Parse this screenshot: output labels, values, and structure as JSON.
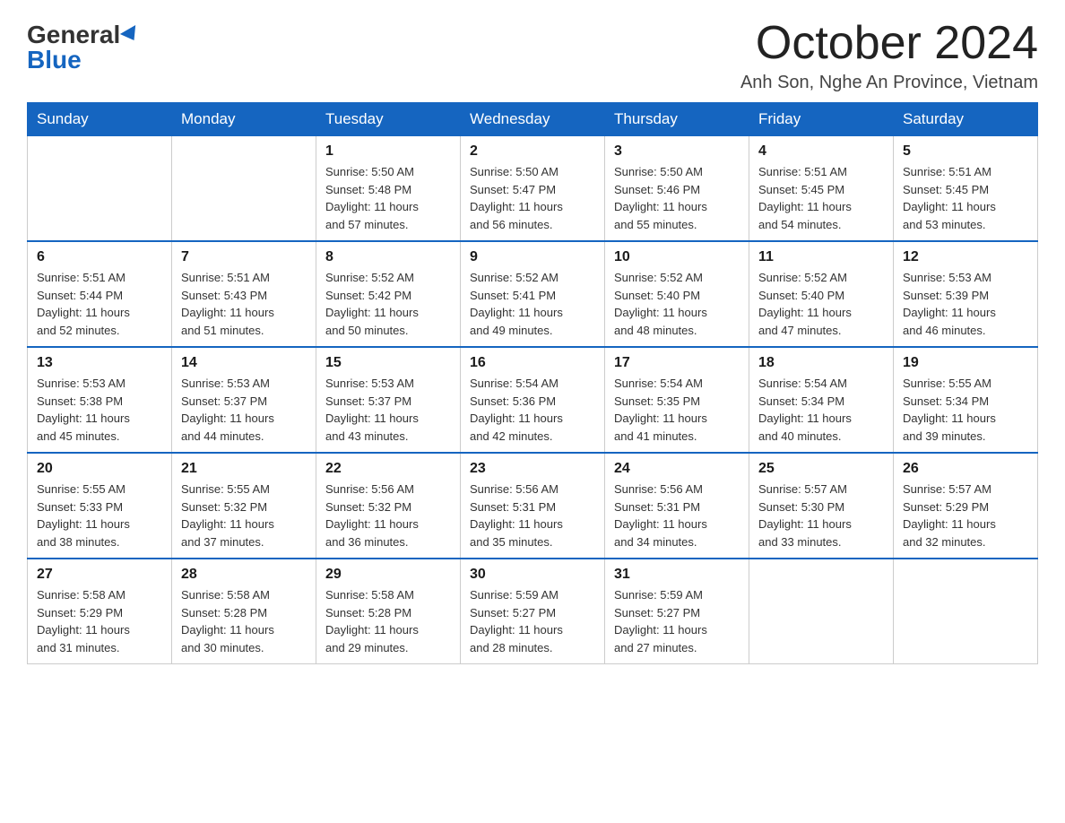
{
  "header": {
    "logo_general": "General",
    "logo_blue": "Blue",
    "title": "October 2024",
    "location": "Anh Son, Nghe An Province, Vietnam"
  },
  "days_of_week": [
    "Sunday",
    "Monday",
    "Tuesday",
    "Wednesday",
    "Thursday",
    "Friday",
    "Saturday"
  ],
  "weeks": [
    [
      {
        "day": "",
        "info": ""
      },
      {
        "day": "",
        "info": ""
      },
      {
        "day": "1",
        "info": "Sunrise: 5:50 AM\nSunset: 5:48 PM\nDaylight: 11 hours\nand 57 minutes."
      },
      {
        "day": "2",
        "info": "Sunrise: 5:50 AM\nSunset: 5:47 PM\nDaylight: 11 hours\nand 56 minutes."
      },
      {
        "day": "3",
        "info": "Sunrise: 5:50 AM\nSunset: 5:46 PM\nDaylight: 11 hours\nand 55 minutes."
      },
      {
        "day": "4",
        "info": "Sunrise: 5:51 AM\nSunset: 5:45 PM\nDaylight: 11 hours\nand 54 minutes."
      },
      {
        "day": "5",
        "info": "Sunrise: 5:51 AM\nSunset: 5:45 PM\nDaylight: 11 hours\nand 53 minutes."
      }
    ],
    [
      {
        "day": "6",
        "info": "Sunrise: 5:51 AM\nSunset: 5:44 PM\nDaylight: 11 hours\nand 52 minutes."
      },
      {
        "day": "7",
        "info": "Sunrise: 5:51 AM\nSunset: 5:43 PM\nDaylight: 11 hours\nand 51 minutes."
      },
      {
        "day": "8",
        "info": "Sunrise: 5:52 AM\nSunset: 5:42 PM\nDaylight: 11 hours\nand 50 minutes."
      },
      {
        "day": "9",
        "info": "Sunrise: 5:52 AM\nSunset: 5:41 PM\nDaylight: 11 hours\nand 49 minutes."
      },
      {
        "day": "10",
        "info": "Sunrise: 5:52 AM\nSunset: 5:40 PM\nDaylight: 11 hours\nand 48 minutes."
      },
      {
        "day": "11",
        "info": "Sunrise: 5:52 AM\nSunset: 5:40 PM\nDaylight: 11 hours\nand 47 minutes."
      },
      {
        "day": "12",
        "info": "Sunrise: 5:53 AM\nSunset: 5:39 PM\nDaylight: 11 hours\nand 46 minutes."
      }
    ],
    [
      {
        "day": "13",
        "info": "Sunrise: 5:53 AM\nSunset: 5:38 PM\nDaylight: 11 hours\nand 45 minutes."
      },
      {
        "day": "14",
        "info": "Sunrise: 5:53 AM\nSunset: 5:37 PM\nDaylight: 11 hours\nand 44 minutes."
      },
      {
        "day": "15",
        "info": "Sunrise: 5:53 AM\nSunset: 5:37 PM\nDaylight: 11 hours\nand 43 minutes."
      },
      {
        "day": "16",
        "info": "Sunrise: 5:54 AM\nSunset: 5:36 PM\nDaylight: 11 hours\nand 42 minutes."
      },
      {
        "day": "17",
        "info": "Sunrise: 5:54 AM\nSunset: 5:35 PM\nDaylight: 11 hours\nand 41 minutes."
      },
      {
        "day": "18",
        "info": "Sunrise: 5:54 AM\nSunset: 5:34 PM\nDaylight: 11 hours\nand 40 minutes."
      },
      {
        "day": "19",
        "info": "Sunrise: 5:55 AM\nSunset: 5:34 PM\nDaylight: 11 hours\nand 39 minutes."
      }
    ],
    [
      {
        "day": "20",
        "info": "Sunrise: 5:55 AM\nSunset: 5:33 PM\nDaylight: 11 hours\nand 38 minutes."
      },
      {
        "day": "21",
        "info": "Sunrise: 5:55 AM\nSunset: 5:32 PM\nDaylight: 11 hours\nand 37 minutes."
      },
      {
        "day": "22",
        "info": "Sunrise: 5:56 AM\nSunset: 5:32 PM\nDaylight: 11 hours\nand 36 minutes."
      },
      {
        "day": "23",
        "info": "Sunrise: 5:56 AM\nSunset: 5:31 PM\nDaylight: 11 hours\nand 35 minutes."
      },
      {
        "day": "24",
        "info": "Sunrise: 5:56 AM\nSunset: 5:31 PM\nDaylight: 11 hours\nand 34 minutes."
      },
      {
        "day": "25",
        "info": "Sunrise: 5:57 AM\nSunset: 5:30 PM\nDaylight: 11 hours\nand 33 minutes."
      },
      {
        "day": "26",
        "info": "Sunrise: 5:57 AM\nSunset: 5:29 PM\nDaylight: 11 hours\nand 32 minutes."
      }
    ],
    [
      {
        "day": "27",
        "info": "Sunrise: 5:58 AM\nSunset: 5:29 PM\nDaylight: 11 hours\nand 31 minutes."
      },
      {
        "day": "28",
        "info": "Sunrise: 5:58 AM\nSunset: 5:28 PM\nDaylight: 11 hours\nand 30 minutes."
      },
      {
        "day": "29",
        "info": "Sunrise: 5:58 AM\nSunset: 5:28 PM\nDaylight: 11 hours\nand 29 minutes."
      },
      {
        "day": "30",
        "info": "Sunrise: 5:59 AM\nSunset: 5:27 PM\nDaylight: 11 hours\nand 28 minutes."
      },
      {
        "day": "31",
        "info": "Sunrise: 5:59 AM\nSunset: 5:27 PM\nDaylight: 11 hours\nand 27 minutes."
      },
      {
        "day": "",
        "info": ""
      },
      {
        "day": "",
        "info": ""
      }
    ]
  ]
}
